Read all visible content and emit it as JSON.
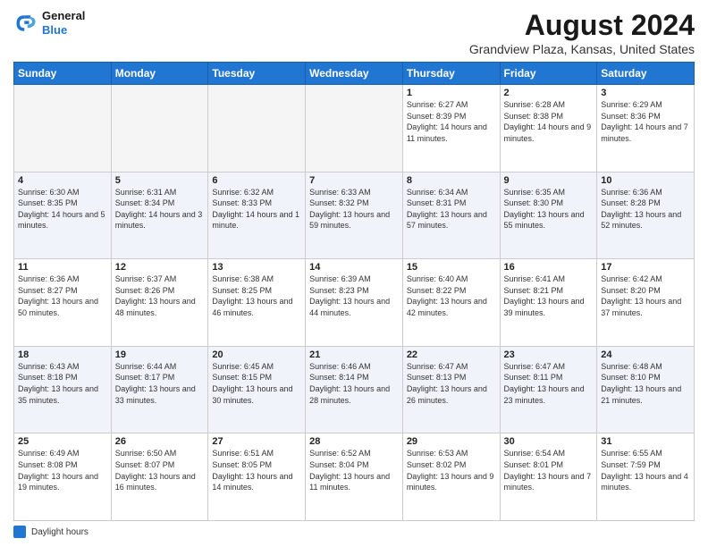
{
  "header": {
    "logo_line1": "General",
    "logo_line2": "Blue",
    "main_title": "August 2024",
    "subtitle": "Grandview Plaza, Kansas, United States"
  },
  "calendar": {
    "days_of_week": [
      "Sunday",
      "Monday",
      "Tuesday",
      "Wednesday",
      "Thursday",
      "Friday",
      "Saturday"
    ],
    "weeks": [
      [
        {
          "date": "",
          "info": ""
        },
        {
          "date": "",
          "info": ""
        },
        {
          "date": "",
          "info": ""
        },
        {
          "date": "",
          "info": ""
        },
        {
          "date": "1",
          "info": "Sunrise: 6:27 AM\nSunset: 8:39 PM\nDaylight: 14 hours and 11 minutes."
        },
        {
          "date": "2",
          "info": "Sunrise: 6:28 AM\nSunset: 8:38 PM\nDaylight: 14 hours and 9 minutes."
        },
        {
          "date": "3",
          "info": "Sunrise: 6:29 AM\nSunset: 8:36 PM\nDaylight: 14 hours and 7 minutes."
        }
      ],
      [
        {
          "date": "4",
          "info": "Sunrise: 6:30 AM\nSunset: 8:35 PM\nDaylight: 14 hours and 5 minutes."
        },
        {
          "date": "5",
          "info": "Sunrise: 6:31 AM\nSunset: 8:34 PM\nDaylight: 14 hours and 3 minutes."
        },
        {
          "date": "6",
          "info": "Sunrise: 6:32 AM\nSunset: 8:33 PM\nDaylight: 14 hours and 1 minute."
        },
        {
          "date": "7",
          "info": "Sunrise: 6:33 AM\nSunset: 8:32 PM\nDaylight: 13 hours and 59 minutes."
        },
        {
          "date": "8",
          "info": "Sunrise: 6:34 AM\nSunset: 8:31 PM\nDaylight: 13 hours and 57 minutes."
        },
        {
          "date": "9",
          "info": "Sunrise: 6:35 AM\nSunset: 8:30 PM\nDaylight: 13 hours and 55 minutes."
        },
        {
          "date": "10",
          "info": "Sunrise: 6:36 AM\nSunset: 8:28 PM\nDaylight: 13 hours and 52 minutes."
        }
      ],
      [
        {
          "date": "11",
          "info": "Sunrise: 6:36 AM\nSunset: 8:27 PM\nDaylight: 13 hours and 50 minutes."
        },
        {
          "date": "12",
          "info": "Sunrise: 6:37 AM\nSunset: 8:26 PM\nDaylight: 13 hours and 48 minutes."
        },
        {
          "date": "13",
          "info": "Sunrise: 6:38 AM\nSunset: 8:25 PM\nDaylight: 13 hours and 46 minutes."
        },
        {
          "date": "14",
          "info": "Sunrise: 6:39 AM\nSunset: 8:23 PM\nDaylight: 13 hours and 44 minutes."
        },
        {
          "date": "15",
          "info": "Sunrise: 6:40 AM\nSunset: 8:22 PM\nDaylight: 13 hours and 42 minutes."
        },
        {
          "date": "16",
          "info": "Sunrise: 6:41 AM\nSunset: 8:21 PM\nDaylight: 13 hours and 39 minutes."
        },
        {
          "date": "17",
          "info": "Sunrise: 6:42 AM\nSunset: 8:20 PM\nDaylight: 13 hours and 37 minutes."
        }
      ],
      [
        {
          "date": "18",
          "info": "Sunrise: 6:43 AM\nSunset: 8:18 PM\nDaylight: 13 hours and 35 minutes."
        },
        {
          "date": "19",
          "info": "Sunrise: 6:44 AM\nSunset: 8:17 PM\nDaylight: 13 hours and 33 minutes."
        },
        {
          "date": "20",
          "info": "Sunrise: 6:45 AM\nSunset: 8:15 PM\nDaylight: 13 hours and 30 minutes."
        },
        {
          "date": "21",
          "info": "Sunrise: 6:46 AM\nSunset: 8:14 PM\nDaylight: 13 hours and 28 minutes."
        },
        {
          "date": "22",
          "info": "Sunrise: 6:47 AM\nSunset: 8:13 PM\nDaylight: 13 hours and 26 minutes."
        },
        {
          "date": "23",
          "info": "Sunrise: 6:47 AM\nSunset: 8:11 PM\nDaylight: 13 hours and 23 minutes."
        },
        {
          "date": "24",
          "info": "Sunrise: 6:48 AM\nSunset: 8:10 PM\nDaylight: 13 hours and 21 minutes."
        }
      ],
      [
        {
          "date": "25",
          "info": "Sunrise: 6:49 AM\nSunset: 8:08 PM\nDaylight: 13 hours and 19 minutes."
        },
        {
          "date": "26",
          "info": "Sunrise: 6:50 AM\nSunset: 8:07 PM\nDaylight: 13 hours and 16 minutes."
        },
        {
          "date": "27",
          "info": "Sunrise: 6:51 AM\nSunset: 8:05 PM\nDaylight: 13 hours and 14 minutes."
        },
        {
          "date": "28",
          "info": "Sunrise: 6:52 AM\nSunset: 8:04 PM\nDaylight: 13 hours and 11 minutes."
        },
        {
          "date": "29",
          "info": "Sunrise: 6:53 AM\nSunset: 8:02 PM\nDaylight: 13 hours and 9 minutes."
        },
        {
          "date": "30",
          "info": "Sunrise: 6:54 AM\nSunset: 8:01 PM\nDaylight: 13 hours and 7 minutes."
        },
        {
          "date": "31",
          "info": "Sunrise: 6:55 AM\nSunset: 7:59 PM\nDaylight: 13 hours and 4 minutes."
        }
      ]
    ]
  },
  "legend": {
    "label": "Daylight hours"
  }
}
